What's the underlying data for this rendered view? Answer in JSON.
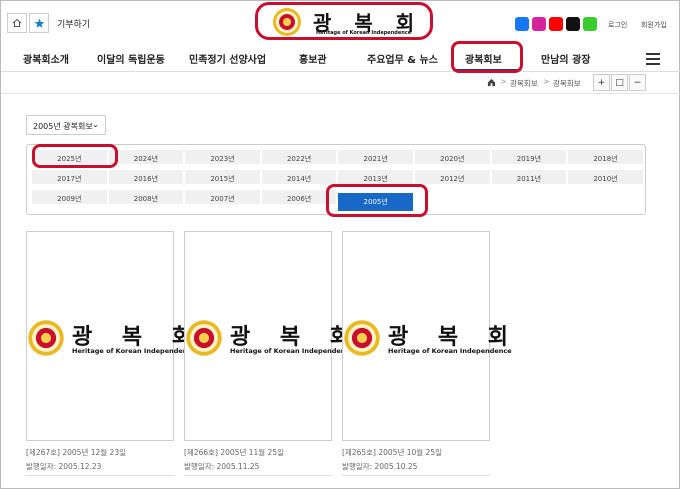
{
  "header": {
    "donate_label": "기부하기",
    "logo_title": "광 복 회",
    "logo_subtitle": "Heritage of Korean Independence",
    "login_label": "로그인",
    "signup_label": "회원가입",
    "social": [
      {
        "name": "facebook-icon",
        "color": "#1877f2"
      },
      {
        "name": "instagram-icon",
        "color": "#d6249f"
      },
      {
        "name": "youtube-icon",
        "color": "#ff0000"
      },
      {
        "name": "tiktok-icon",
        "color": "#111111"
      },
      {
        "name": "line-icon",
        "color": "#3acc2c"
      }
    ]
  },
  "nav": {
    "items": [
      "광복회소개",
      "이달의 독립운동",
      "민족정기 선양사업",
      "홍보관",
      "주요업무 & 뉴스",
      "광복회보",
      "만남의 광장"
    ]
  },
  "breadcrumb": {
    "items": [
      "광복회보",
      "광복회보"
    ],
    "controls": [
      "+",
      "□",
      "−"
    ]
  },
  "filter": {
    "selected_year": "2005년 광복회보"
  },
  "years": {
    "rows": [
      [
        "2025년",
        "2024년",
        "2023년",
        "2022년",
        "2021년",
        "2020년",
        "2019년",
        "2018년"
      ],
      [
        "2017년",
        "2016년",
        "2015년",
        "2014년",
        "2013년",
        "2012년",
        "2011년",
        "2010년"
      ],
      [
        "2009년",
        "2008년",
        "2007년",
        "2006년",
        "2005년"
      ]
    ],
    "active": "2005년"
  },
  "cards": [
    {
      "title": "광 복 회",
      "subtitle": "Heritage of Korean Independence",
      "issue": "[제267호] 2005년 12월 23일",
      "published": "발행일자: 2005.12.23"
    },
    {
      "title": "광 복 회",
      "subtitle": "Heritage of Korean Independence",
      "issue": "[제266호] 2005년 11월 25일",
      "published": "발행일자: 2005.11.25"
    },
    {
      "title": "광 복 회",
      "subtitle": "Heritage of Korean Independence",
      "issue": "[제265호] 2005년 10월 25일",
      "published": "발행일자: 2005.10.25"
    }
  ],
  "colors": {
    "highlight": "#c8102e",
    "active_year": "#1868c8",
    "nav_underline": "#1a3a7a"
  }
}
